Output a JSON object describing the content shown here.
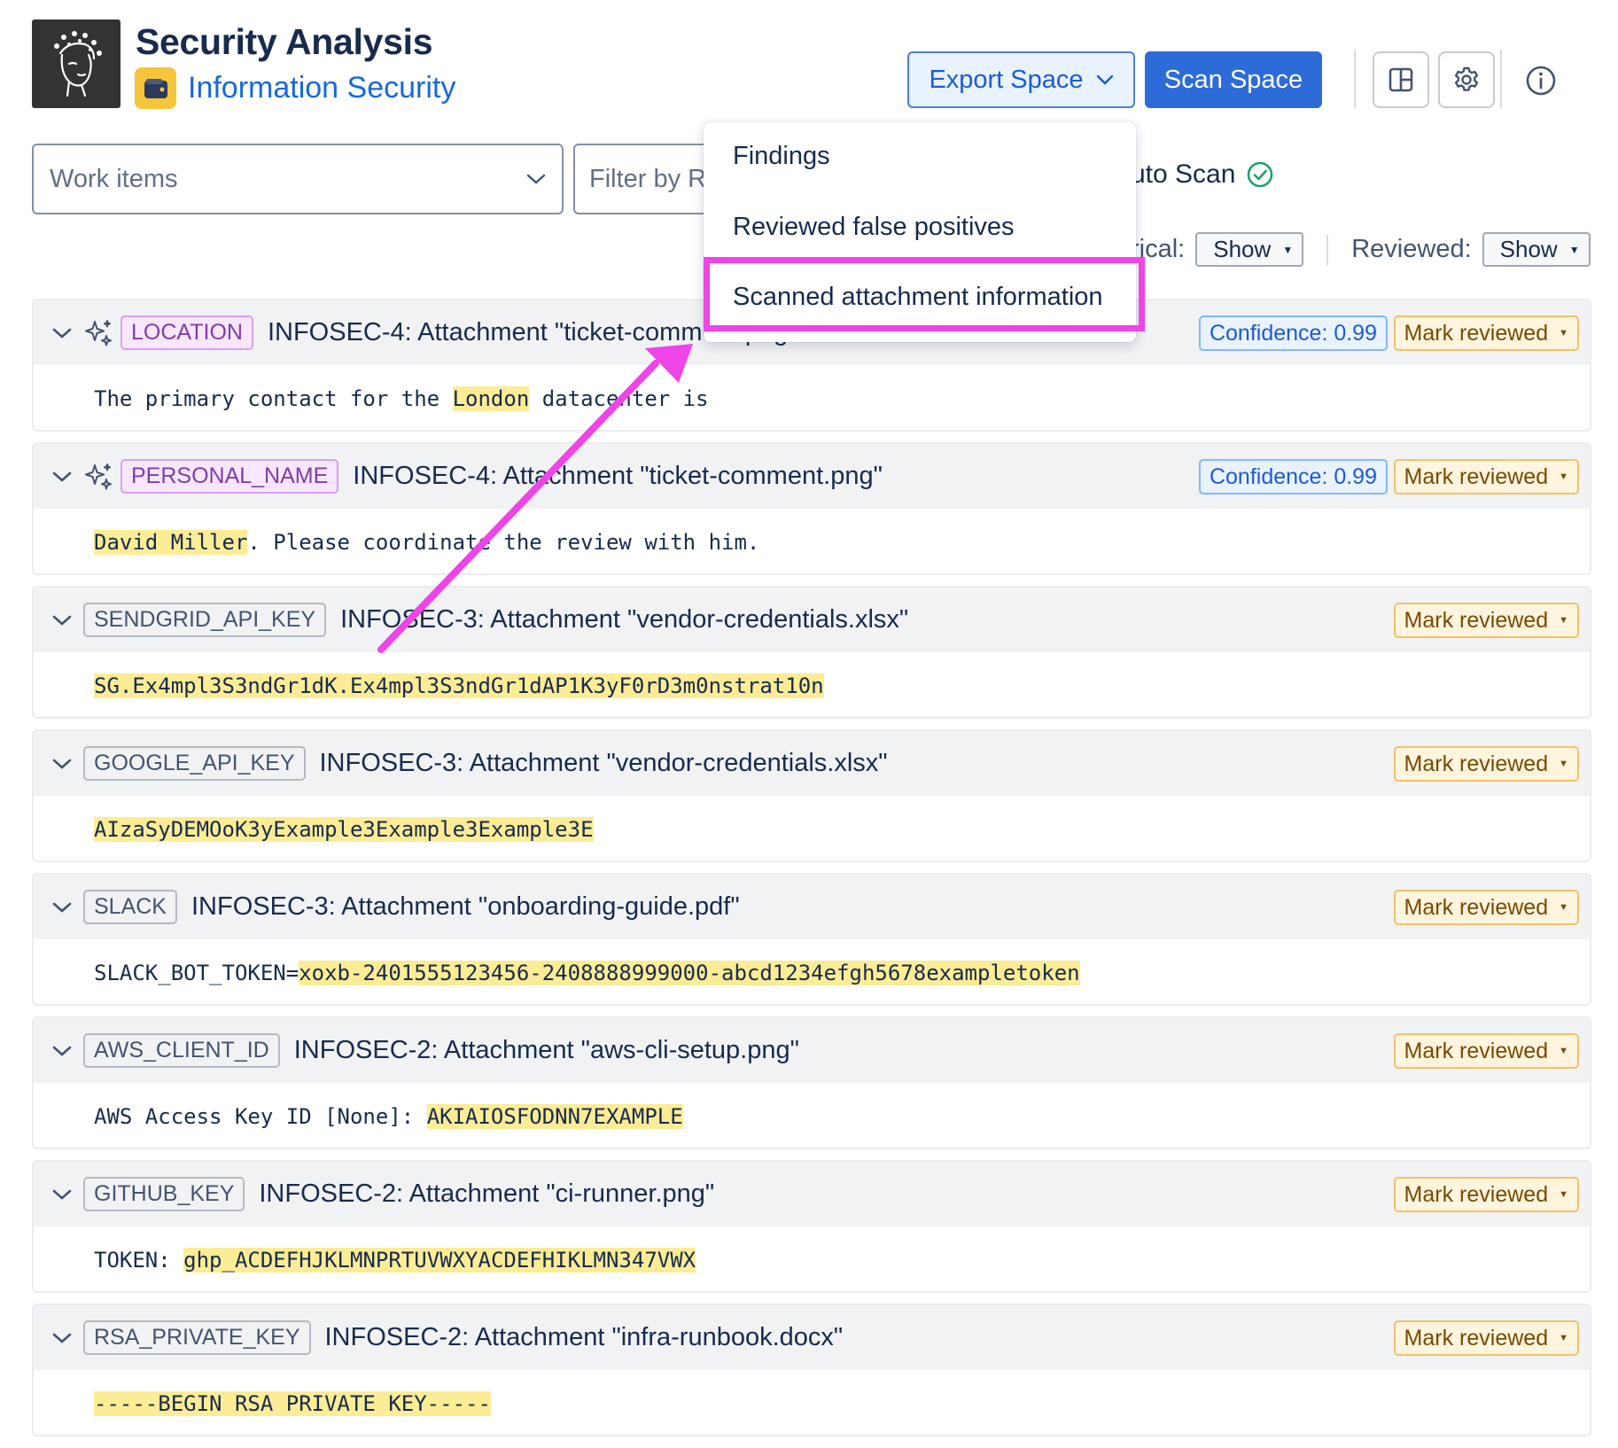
{
  "header": {
    "title": "Security Analysis",
    "space_name": "Information Security",
    "export_label": "Export Space",
    "scan_label": "Scan Space"
  },
  "filters": {
    "work_items": "Work items",
    "filter_placeholder": "Filter by R",
    "auto_scan": "uto Scan",
    "historical_label": "rical:",
    "historical_value": "Show",
    "reviewed_label": "Reviewed:",
    "reviewed_value": "Show"
  },
  "export_menu": {
    "items": [
      "Findings",
      "Reviewed false positives",
      "Scanned attachment information"
    ],
    "highlighted": "Scanned attachment information"
  },
  "findings": [
    {
      "tag": "LOCATION",
      "ai": true,
      "title": "INFOSEC-4: Attachment \"ticket-comment.png\"",
      "confidence": "Confidence: 0.99",
      "mark": "Mark reviewed",
      "pre": "The primary contact for the ",
      "match": "London",
      "post": " datacenter is"
    },
    {
      "tag": "PERSONAL_NAME",
      "ai": true,
      "title": "INFOSEC-4: Attachment \"ticket-comment.png\"",
      "confidence": "Confidence: 0.99",
      "mark": "Mark reviewed",
      "pre": "",
      "match": "David Miller",
      "post": ". Please coordinate the review with him."
    },
    {
      "tag": "SENDGRID_API_KEY",
      "ai": false,
      "title": "INFOSEC-3: Attachment \"vendor-credentials.xlsx\"",
      "confidence": "",
      "mark": "Mark reviewed",
      "pre": "",
      "match": "SG.Ex4mpl3S3ndGr1dK.Ex4mpl3S3ndGr1dAP1K3yF0rD3m0nstrat10n",
      "post": ""
    },
    {
      "tag": "GOOGLE_API_KEY",
      "ai": false,
      "title": "INFOSEC-3: Attachment \"vendor-credentials.xlsx\"",
      "confidence": "",
      "mark": "Mark reviewed",
      "pre": "",
      "match": "AIzaSyDEMOoK3yExample3Example3Example3E",
      "post": ""
    },
    {
      "tag": "SLACK",
      "ai": false,
      "title": "INFOSEC-3: Attachment \"onboarding-guide.pdf\"",
      "confidence": "",
      "mark": "Mark reviewed",
      "pre": "SLACK_BOT_TOKEN=",
      "match": "xoxb-2401555123456-2408888999000-abcd1234efgh5678exampletoken",
      "post": ""
    },
    {
      "tag": "AWS_CLIENT_ID",
      "ai": false,
      "title": "INFOSEC-2: Attachment \"aws-cli-setup.png\"",
      "confidence": "",
      "mark": "Mark reviewed",
      "pre": "AWS Access Key ID [None]: ",
      "match": "AKIAIOSFODNN7EXAMPLE",
      "post": ""
    },
    {
      "tag": "GITHUB_KEY",
      "ai": false,
      "title": "INFOSEC-2: Attachment \"ci-runner.png\"",
      "confidence": "",
      "mark": "Mark reviewed",
      "pre": "TOKEN: ",
      "match": "ghp_ACDEFHJKLMNPRTUVWXYACDEFHIKLMN347VWX",
      "post": ""
    },
    {
      "tag": "RSA_PRIVATE_KEY",
      "ai": false,
      "title": "INFOSEC-2: Attachment \"infra-runbook.docx\"",
      "confidence": "",
      "mark": "Mark reviewed",
      "pre": "",
      "match": "-----BEGIN RSA PRIVATE KEY-----",
      "post": ""
    }
  ],
  "colors": {
    "primary": "#2d6bd9",
    "annotation": "#ee44e8",
    "highlight": "#fcec95",
    "purple_tag": "#f8e6ff",
    "mark_badge": "#fff4de"
  }
}
